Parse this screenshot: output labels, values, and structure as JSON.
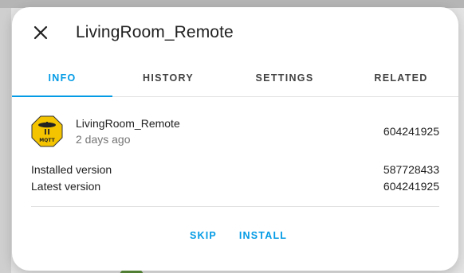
{
  "dialog": {
    "title": "LivingRoom_Remote",
    "close_icon": "close-icon"
  },
  "tabs": [
    {
      "label": "INFO",
      "active": true
    },
    {
      "label": "HISTORY",
      "active": false
    },
    {
      "label": "SETTINGS",
      "active": false
    },
    {
      "label": "RELATED",
      "active": false
    }
  ],
  "entity": {
    "name": "LivingRoom_Remote",
    "subtitle": "2 days ago",
    "value": "604241925",
    "icon": "mqtt-logo-icon",
    "icon_text": "MQTT"
  },
  "info": [
    {
      "label": "Installed version",
      "value": "587728433"
    },
    {
      "label": "Latest version",
      "value": "604241925"
    }
  ],
  "actions": {
    "skip_label": "SKIP",
    "install_label": "INSTALL"
  },
  "colors": {
    "accent": "#039be5",
    "logo_fill": "#f5c400"
  }
}
